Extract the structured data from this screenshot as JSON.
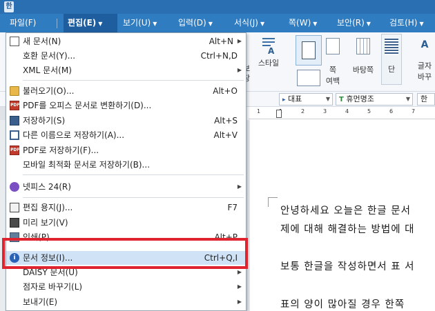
{
  "menubar": {
    "items": [
      {
        "label": "파일(F)",
        "caret": false
      },
      {
        "label": "편집(E)",
        "caret": true
      },
      {
        "label": "보기(U)",
        "caret": true
      },
      {
        "label": "입력(D)",
        "caret": true
      },
      {
        "label": "서식(J)",
        "caret": true
      },
      {
        "label": "쪽(W)",
        "caret": true
      },
      {
        "label": "보안(R)",
        "caret": true
      },
      {
        "label": "검토(H)",
        "caret": true
      }
    ],
    "caret_glyph": "▼"
  },
  "ribbon": {
    "style_label": "스타일",
    "margin_label_1": "쪽",
    "margin_label_2": "여백",
    "background_label": "바탕쪽",
    "column_label": "단",
    "font_change_label_1": "글자",
    "font_change_label_2": "바꾸",
    "partial_label_1": "보",
    "partial_label_2": "장"
  },
  "formatbar": {
    "style_combo": "대표",
    "font_combo": "휴먼명조",
    "size_combo": "한"
  },
  "ruler": {
    "numbers": [
      "1",
      "1",
      "2",
      "3",
      "4",
      "5",
      "6",
      "7"
    ]
  },
  "document": {
    "lines": [
      "안녕하세요 오늘은 한글 문서",
      "제에 대해 해결하는 방법에 대",
      "보통 한글을 작성하면서 표 서",
      "표의 양이 많아질 경우 한쪽"
    ]
  },
  "file_menu": {
    "items": [
      {
        "label": "새 문서(N)",
        "shortcut": "Alt+N",
        "submenu": true,
        "icon": "new-document-icon"
      },
      {
        "label": "호환 문서(Y)...",
        "shortcut": "Ctrl+N,D",
        "submenu": false,
        "icon": ""
      },
      {
        "label": "XML 문서(M)",
        "shortcut": "",
        "submenu": true,
        "icon": ""
      },
      {
        "label": "불러오기(O)...",
        "shortcut": "Alt+O",
        "submenu": false,
        "icon": "open-folder-icon"
      },
      {
        "label": "PDF를 오피스 문서로 변환하기(D)...",
        "shortcut": "",
        "submenu": false,
        "icon": "pdf-convert-icon"
      },
      {
        "label": "저장하기(S)",
        "shortcut": "Alt+S",
        "submenu": false,
        "icon": "save-icon"
      },
      {
        "label": "다른 이름으로 저장하기(A)...",
        "shortcut": "Alt+V",
        "submenu": false,
        "icon": "save-as-icon"
      },
      {
        "label": "PDF로 저장하기(F)...",
        "shortcut": "",
        "submenu": false,
        "icon": "save-pdf-icon"
      },
      {
        "label": "모바일 최적화 문서로 저장하기(B)...",
        "shortcut": "",
        "submenu": false,
        "icon": ""
      },
      {
        "label": "넷피스 24(R)",
        "shortcut": "",
        "submenu": true,
        "icon": "netffice-icon"
      },
      {
        "label": "편집 용지(J)...",
        "shortcut": "F7",
        "submenu": false,
        "icon": "page-setup-icon"
      },
      {
        "label": "미리 보기(V)",
        "shortcut": "",
        "submenu": false,
        "icon": "preview-icon"
      },
      {
        "label": "인쇄(P)...",
        "shortcut": "Alt+P",
        "submenu": false,
        "icon": "print-icon"
      },
      {
        "label": "문서 정보(I)...",
        "shortcut": "Ctrl+Q,I",
        "submenu": false,
        "icon": "info-icon"
      },
      {
        "label": "DAISY 문서(U)",
        "shortcut": "",
        "submenu": true,
        "icon": ""
      },
      {
        "label": "점자로 바꾸기(L)",
        "shortcut": "",
        "submenu": true,
        "icon": ""
      },
      {
        "label": "보내기(E)",
        "shortcut": "",
        "submenu": true,
        "icon": ""
      }
    ],
    "submenu_glyph": "▶",
    "highlighted_item": "문서 정보(I)..."
  },
  "colors": {
    "menubar_bg": "#2f7cc1",
    "highlight_border": "#e0242f",
    "selected_item_bg": "#cfe2f6"
  }
}
